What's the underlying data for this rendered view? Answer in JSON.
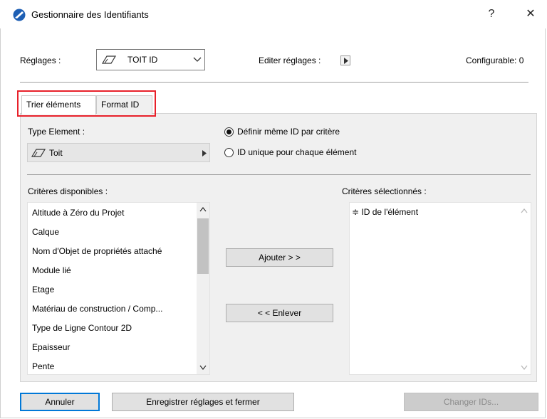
{
  "window": {
    "title": "Gestionnaire des Identifiants",
    "help_label": "?",
    "close_label": "✕"
  },
  "settings": {
    "label": "Réglages :",
    "selected_value": "TOIT ID",
    "edit_label": "Editer réglages :",
    "configurable_label": "Configurable: 0"
  },
  "tabs": [
    {
      "label": "Trier éléments"
    },
    {
      "label": "Format ID"
    }
  ],
  "sort": {
    "type_label": "Type Element :",
    "type_value": "Toit",
    "radio_same": "Définir même ID par critère",
    "radio_unique": "ID unique pour chaque élément",
    "available_label": "Critères disponibles :",
    "available_items": [
      "Altitude à Zéro du Projet",
      "Calque",
      "Nom d'Objet de propriétés attaché",
      "Module lié",
      "Etage",
      "Matériau de construction / Comp...",
      "Type de Ligne Contour 2D",
      "Epaisseur",
      "Pente"
    ],
    "selected_label": "Critères sélectionnés :",
    "selected_items": [
      "≑ ID de l'élément"
    ],
    "add_button": "Ajouter > >",
    "remove_button": "< < Enlever"
  },
  "footer": {
    "cancel": "Annuler",
    "save_close": "Enregistrer réglages et fermer",
    "change_ids": "Changer IDs..."
  }
}
